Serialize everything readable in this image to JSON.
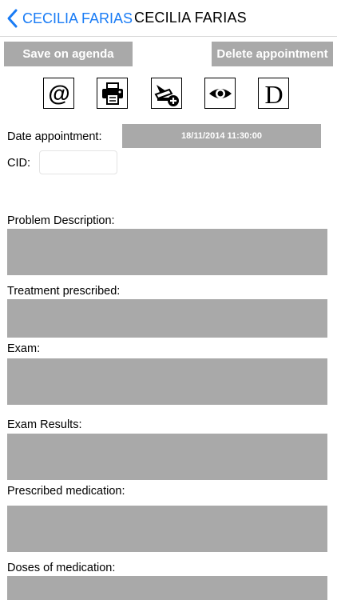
{
  "nav": {
    "back_label": "CECILIA FARIAS",
    "title": "CECILIA FARIAS"
  },
  "toolbar": {
    "save_label": "Save on agenda",
    "delete_label": "Delete appointment",
    "icons": [
      "email-icon",
      "printer-icon",
      "scanner-add-icon",
      "eye-icon",
      "letter-d-icon"
    ]
  },
  "form": {
    "date_label": "Date appointment:",
    "date_value": "18/11/2014 11:30:00",
    "cid_label": "CID:",
    "cid_value": "",
    "problem_label": "Problem Description:",
    "treatment_label": "Treatment prescribed:",
    "exam_label": "Exam:",
    "exam_results_label": "Exam Results:",
    "medication_label": "Prescribed medication:",
    "doses_label": "Doses of medication:"
  },
  "colors": {
    "accent": "#1a7cf5",
    "button_gray": "#a9a9a9"
  }
}
